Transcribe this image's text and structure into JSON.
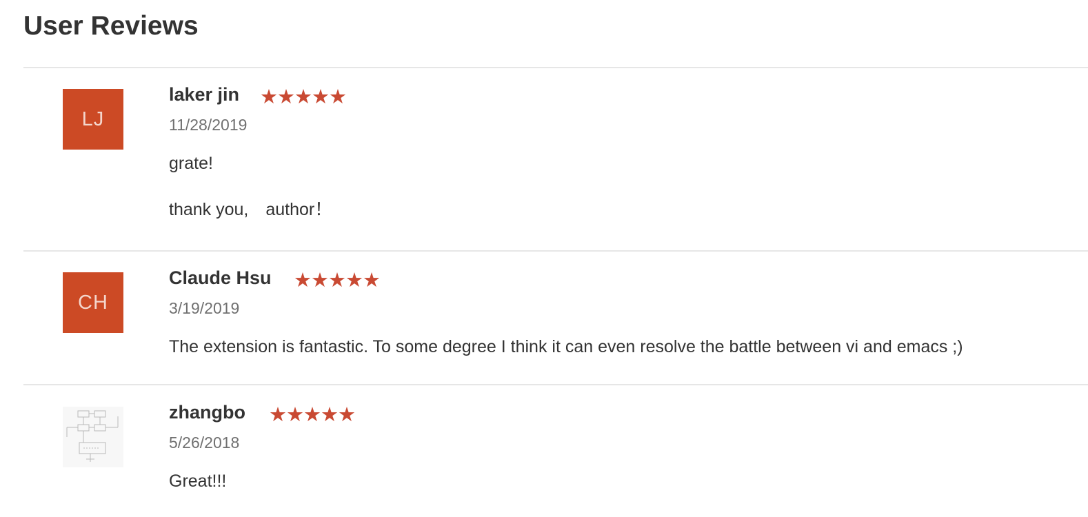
{
  "section": {
    "title": "User Reviews"
  },
  "colors": {
    "accent": "#cc4a25",
    "star": "#c94a33",
    "divider": "#e6e6e6",
    "date_text": "#707070"
  },
  "reviews": [
    {
      "avatar_initials": "LJ",
      "name": "laker jin",
      "rating": 5,
      "rating_max": 5,
      "stars": "★★★★★",
      "date": "11/28/2019",
      "paragraphs": [
        "grate!",
        "thank you,　author！"
      ]
    },
    {
      "avatar_initials": "CH",
      "name": "Claude Hsu",
      "rating": 5,
      "rating_max": 5,
      "stars": "★★★★★",
      "date": "3/19/2019",
      "paragraphs": [
        "The extension is fantastic. To some degree I think it can even resolve the battle between vi and emacs ;)"
      ]
    },
    {
      "avatar_icon": "diagram-thumbnail-icon",
      "name": "zhangbo",
      "rating": 5,
      "rating_max": 5,
      "stars": "★★★★★",
      "date": "5/26/2018",
      "paragraphs": [
        "Great!!!"
      ]
    }
  ]
}
